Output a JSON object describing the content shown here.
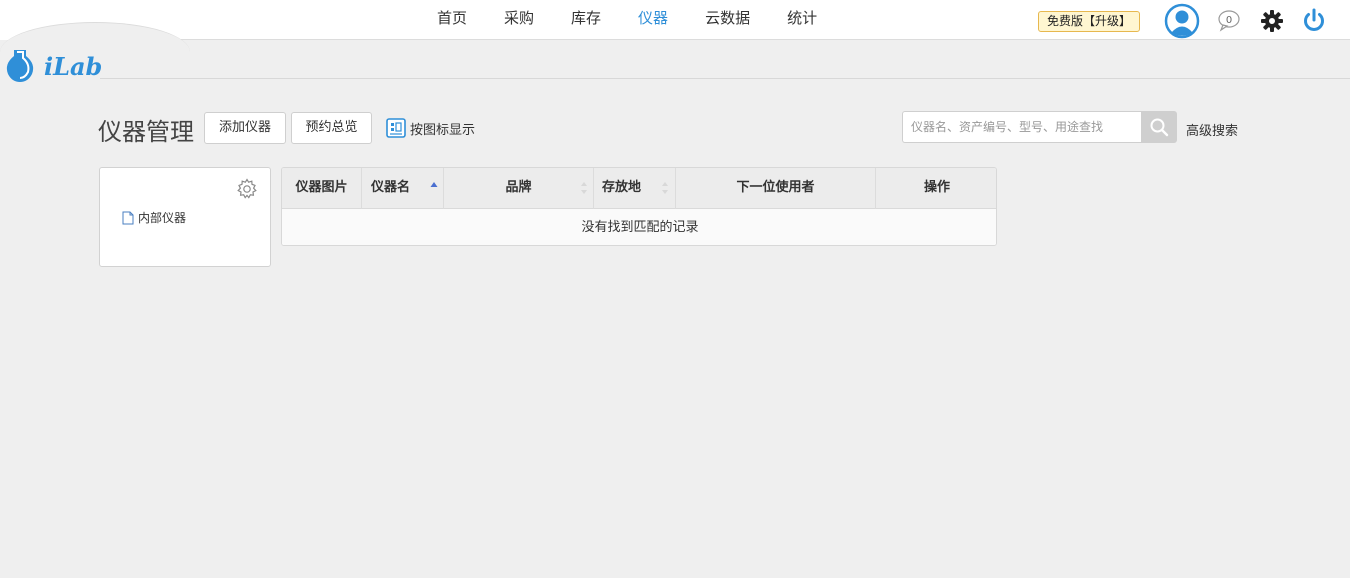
{
  "nav": {
    "items": [
      {
        "label": "首页",
        "active": false
      },
      {
        "label": "采购",
        "active": false
      },
      {
        "label": "库存",
        "active": false
      },
      {
        "label": "仪器",
        "active": true
      },
      {
        "label": "云数据",
        "active": false
      },
      {
        "label": "统计",
        "active": false
      }
    ]
  },
  "header": {
    "upgrade_badge": "免费版【升级】",
    "message_count": "0",
    "icons": [
      "avatar-icon",
      "message-icon",
      "gear-icon",
      "power-icon"
    ]
  },
  "logo": {
    "text": "iLab"
  },
  "page": {
    "title": "仪器管理",
    "add_button": "添加仪器",
    "overview_button": "预约总览",
    "icon_view_label": "按图标显示"
  },
  "search": {
    "placeholder": "仪器名、资产编号、型号、用途查找",
    "advanced_label": "高级搜索"
  },
  "left_panel": {
    "items": [
      {
        "label": "内部仪器"
      }
    ]
  },
  "table": {
    "columns": [
      {
        "label": "仪器图片",
        "sortable": false
      },
      {
        "label": "仪器名",
        "sortable": true,
        "sort": "asc"
      },
      {
        "label": "品牌",
        "sortable": true,
        "sort": "none"
      },
      {
        "label": "存放地",
        "sortable": true,
        "sort": "none"
      },
      {
        "label": "下一位使用者",
        "sortable": false
      },
      {
        "label": "操作",
        "sortable": false
      }
    ],
    "empty_message": "没有找到匹配的记录"
  },
  "colors": {
    "accent": "#2f8fd8",
    "badge_bg": "#fff6d1",
    "badge_border": "#e7b84f",
    "background": "#efefef"
  }
}
